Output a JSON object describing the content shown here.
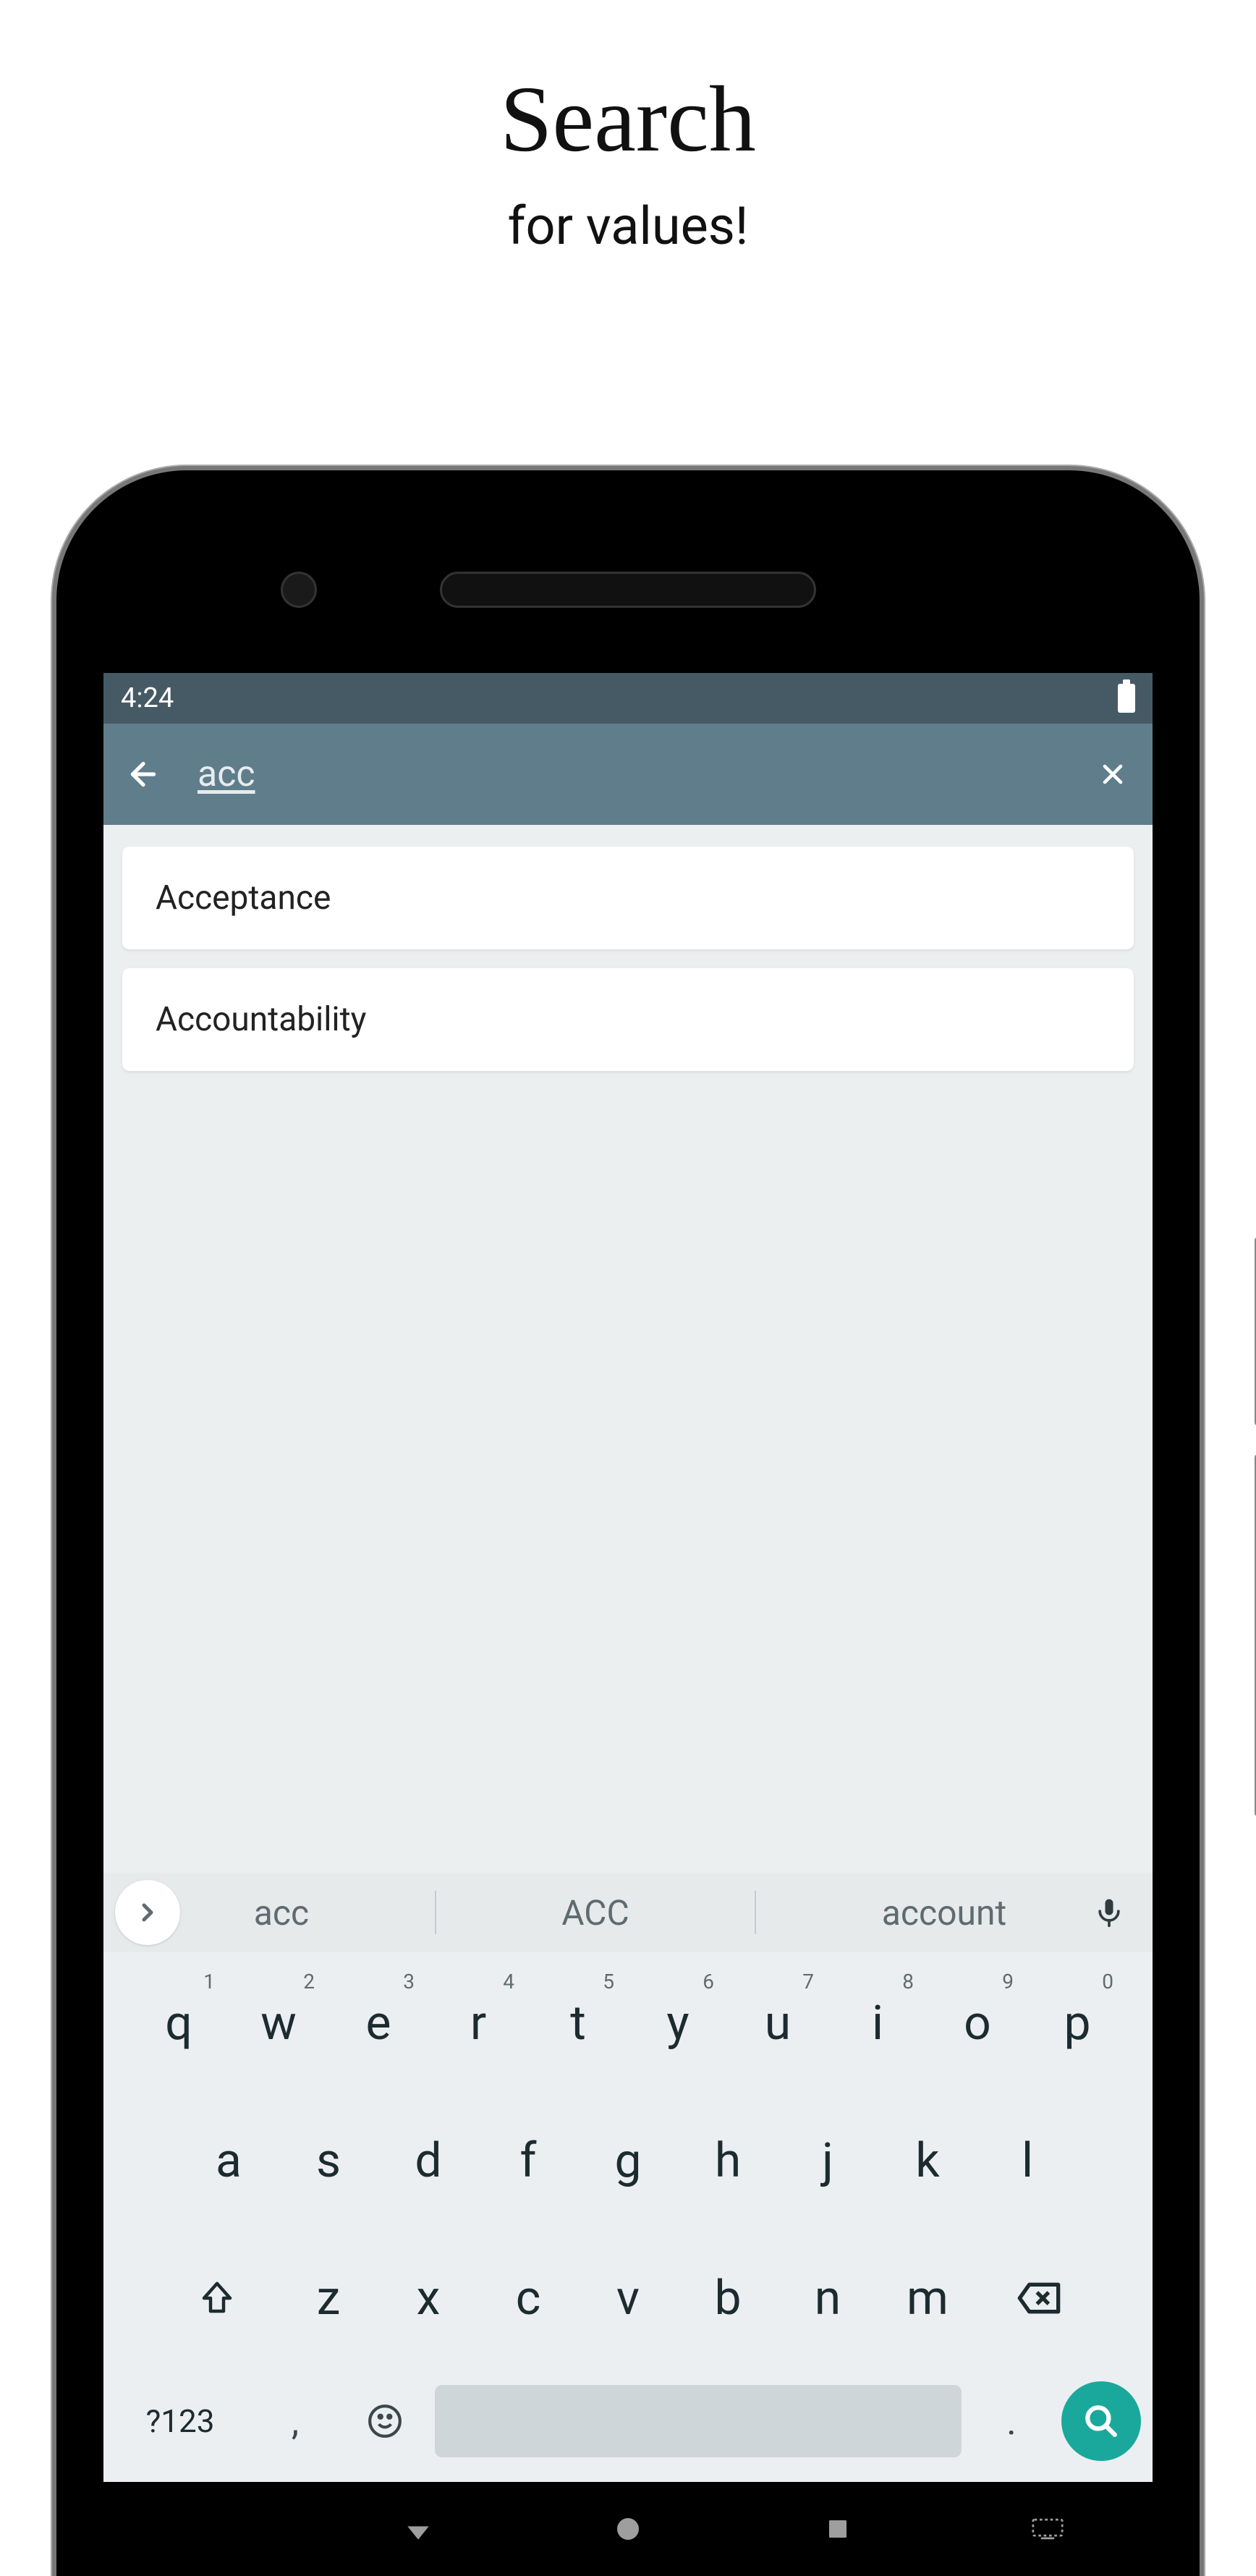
{
  "promo": {
    "title": "Search",
    "subtitle": "for values!"
  },
  "status": {
    "time": "4:24"
  },
  "appbar": {
    "query": "acc"
  },
  "results": [
    {
      "label": "Acceptance"
    },
    {
      "label": "Accountability"
    }
  ],
  "keyboard": {
    "suggestions": [
      "acc",
      "ACC",
      "account"
    ],
    "row1": [
      {
        "k": "q",
        "s": "1"
      },
      {
        "k": "w",
        "s": "2"
      },
      {
        "k": "e",
        "s": "3"
      },
      {
        "k": "r",
        "s": "4"
      },
      {
        "k": "t",
        "s": "5"
      },
      {
        "k": "y",
        "s": "6"
      },
      {
        "k": "u",
        "s": "7"
      },
      {
        "k": "i",
        "s": "8"
      },
      {
        "k": "o",
        "s": "9"
      },
      {
        "k": "p",
        "s": "0"
      }
    ],
    "row2": [
      "a",
      "s",
      "d",
      "f",
      "g",
      "h",
      "j",
      "k",
      "l"
    ],
    "row3": [
      "z",
      "x",
      "c",
      "v",
      "b",
      "n",
      "m"
    ],
    "mode_label": "?123",
    "comma": ",",
    "dot": "."
  }
}
